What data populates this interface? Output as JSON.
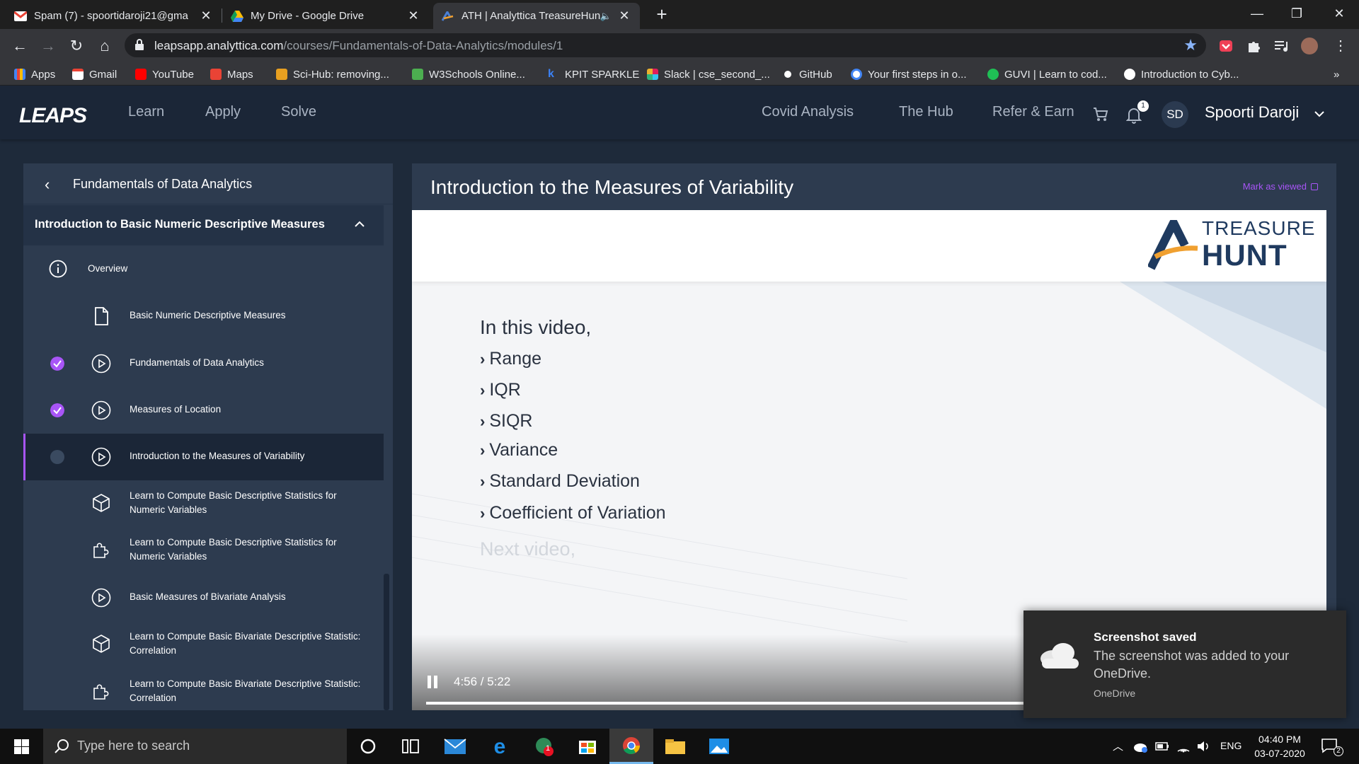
{
  "browser": {
    "tabs": [
      {
        "title": "Spam (7) - spoortidaroji21@gma",
        "favicon": "gmail-icon"
      },
      {
        "title": "My Drive - Google Drive",
        "favicon": "drive-icon"
      },
      {
        "title": "ATH | Analyttica TreasureHun",
        "favicon": "ath-icon",
        "active": true
      }
    ],
    "url_host": "leapsapp.analyttica.com",
    "url_path": "/courses/Fundamentals-of-Data-Analytics/modules/1",
    "bookmarks": [
      "Apps",
      "Gmail",
      "YouTube",
      "Maps",
      "Sci-Hub: removing...",
      "W3Schools Online...",
      "KPIT SPARKLE",
      "Slack | cse_second_...",
      "GitHub",
      "Your first steps in o...",
      "GUVI | Learn to cod...",
      "Introduction to Cyb..."
    ],
    "more_bookmarks": "»"
  },
  "header": {
    "logo": "LEAPS",
    "nav_left": [
      "Learn",
      "Apply",
      "Solve"
    ],
    "nav_right": [
      "Covid Analysis",
      "The Hub",
      "Refer & Earn"
    ],
    "notification_count": "1",
    "avatar_initials": "SD",
    "user_name": "Spoorti Daroji"
  },
  "sidebar": {
    "course_title": "Fundamentals of Data Analytics",
    "section_title": "Introduction to Basic Numeric Descriptive Measures",
    "items": [
      {
        "label": "Overview",
        "icon": "info-icon",
        "status": "none"
      },
      {
        "label": "Basic Numeric Descriptive Measures",
        "icon": "document-icon",
        "status": "none"
      },
      {
        "label": "Fundamentals of Data Analytics",
        "icon": "play-icon",
        "status": "done"
      },
      {
        "label": "Measures of Location",
        "icon": "play-icon",
        "status": "done"
      },
      {
        "label": "Introduction to the Measures of Variability",
        "icon": "play-icon",
        "status": "current"
      },
      {
        "label": "Learn to Compute Basic Descriptive Statistics for Numeric Variables",
        "icon": "cube-icon",
        "status": "none"
      },
      {
        "label": "Learn to Compute Basic Descriptive Statistics for Numeric Variables",
        "icon": "puzzle-icon",
        "status": "none"
      },
      {
        "label": "Basic Measures of Bivariate Analysis",
        "icon": "play-icon",
        "status": "none"
      },
      {
        "label": "Learn to Compute Basic Bivariate Descriptive Statistic: Correlation",
        "icon": "cube-icon",
        "status": "none"
      },
      {
        "label": "Learn to Compute Basic Bivariate Descriptive Statistic: Correlation",
        "icon": "puzzle-icon",
        "status": "none"
      }
    ]
  },
  "content": {
    "title": "Introduction to the Measures of Variability",
    "mark_viewed": "Mark as viewed",
    "video": {
      "brand_top": "TREASURE",
      "brand_bottom": "HUNT",
      "heading": "In this video,",
      "bullets": [
        "Range",
        "IQR",
        "SIQR",
        "Variance",
        "Standard Deviation",
        "Coefficient of Variation"
      ],
      "next": "Next video,",
      "time": "4:56 / 5:22",
      "progress": 0.9193
    }
  },
  "toast": {
    "title": "Screenshot saved",
    "body": "The screenshot was added to your OneDrive.",
    "source": "OneDrive"
  },
  "taskbar": {
    "search_placeholder": "Type here to search",
    "language": "ENG",
    "time": "04:40 PM",
    "date": "03-07-2020",
    "notification_badge": "2",
    "whatsapp_badge": "1"
  },
  "colors": {
    "accent": "#a855f7",
    "header_bg": "#1b2637",
    "panel_bg": "#2d3b4f"
  }
}
